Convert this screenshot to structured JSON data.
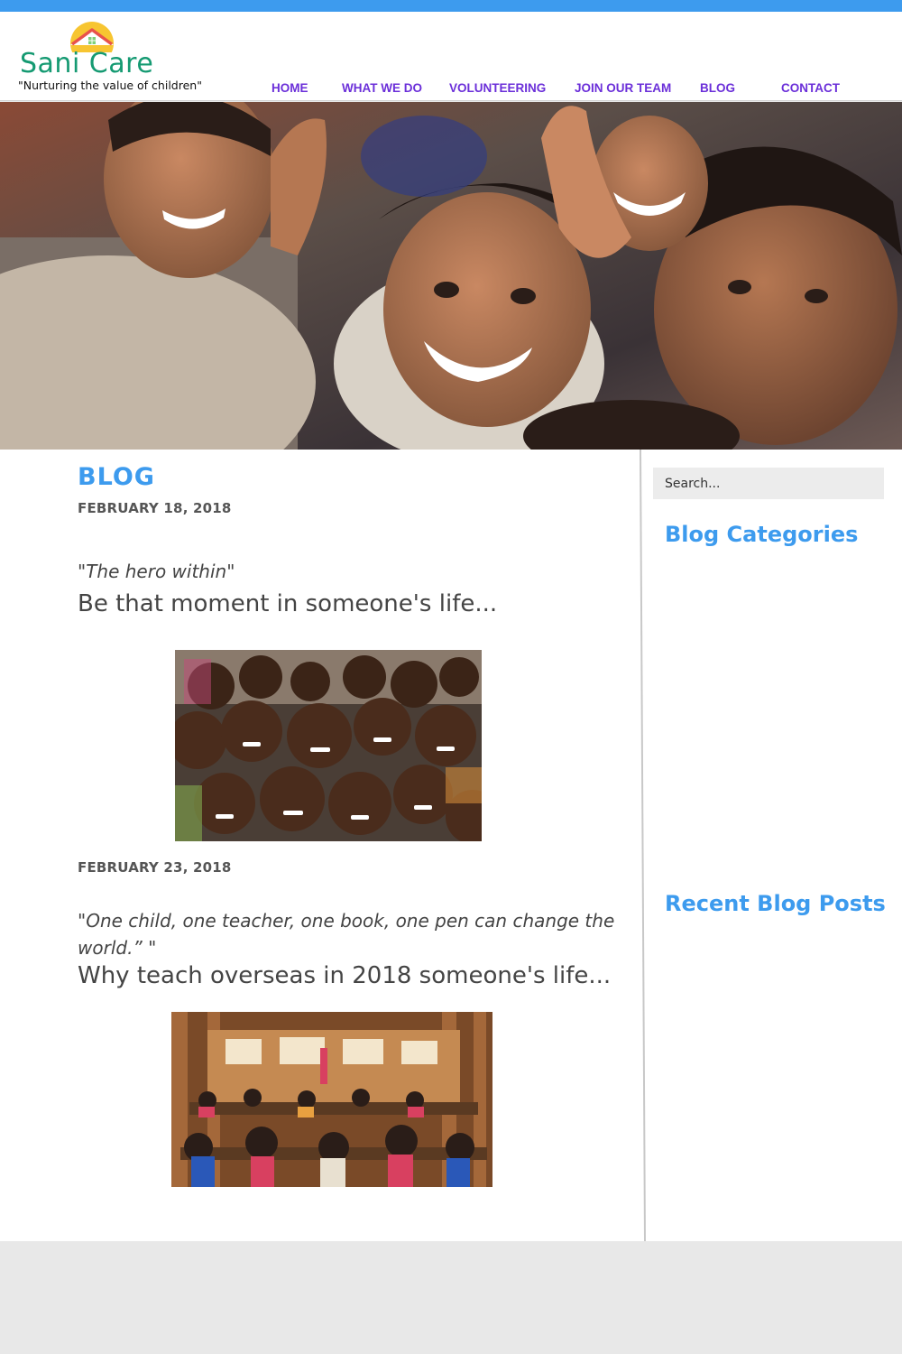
{
  "brand": {
    "name": "Sani Care",
    "tagline": "\"Nurturing the value of children\"",
    "color": "#159a72"
  },
  "nav": {
    "items": [
      {
        "label": "HOME"
      },
      {
        "label": "WHAT WE DO"
      },
      {
        "label": "VOLUNTEERING"
      },
      {
        "label": "JOIN OUR TEAM"
      },
      {
        "label": "BLOG"
      },
      {
        "label": "CONTACT"
      }
    ],
    "color": "#6b2fd9"
  },
  "main": {
    "title": "BLOG",
    "posts": [
      {
        "date": "FEBRUARY 18, 2018",
        "quote": "\"The hero within\"",
        "lead": "Be that moment in someone's life..."
      },
      {
        "date": "FEBRUARY 23, 2018",
        "quote": "\"One child, one teacher, one book, one pen can change the world.” \"",
        "lead": "Why teach overseas in 2018  someone's life..."
      }
    ]
  },
  "sidebar": {
    "search_placeholder": "Search...",
    "categories_title": "Blog Categories",
    "recent_title": "Recent Blog Posts"
  },
  "colors": {
    "accent": "#3d9bee",
    "nav": "#6b2fd9",
    "footer": "#e8e8e8"
  }
}
